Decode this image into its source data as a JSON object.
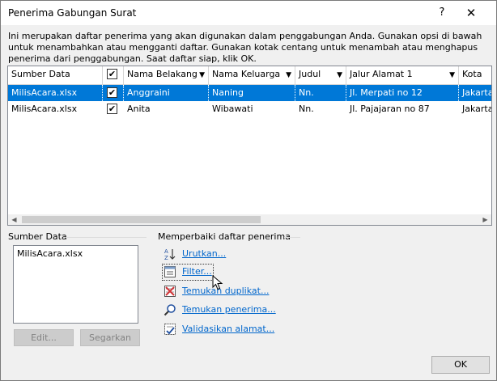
{
  "window": {
    "title": "Penerima Gabungan Surat",
    "help": "?",
    "close": "✕"
  },
  "description": "Ini merupakan daftar penerima yang akan digunakan dalam penggabungan Anda. Gunakan opsi di bawah untuk menambahkan atau mengganti daftar. Gunakan kotak centang untuk menambah atau menghapus penerima dari penggabungan. Saat daftar siap, klik OK.",
  "grid": {
    "columns": [
      {
        "key": "source",
        "label": "Sumber Data"
      },
      {
        "key": "check",
        "label": ""
      },
      {
        "key": "last",
        "label": "Nama Belakang"
      },
      {
        "key": "family",
        "label": "Nama Keluarga"
      },
      {
        "key": "title",
        "label": "Judul"
      },
      {
        "key": "address",
        "label": "Jalur Alamat 1"
      },
      {
        "key": "city",
        "label": "Kota"
      }
    ],
    "header_checkbox": "✔",
    "rows": [
      {
        "source": "MilisAcara.xlsx",
        "check": "✔",
        "last": "Anggraini",
        "family": "Naning",
        "title": "Nn.",
        "address": "Jl. Merpati no 12",
        "city": "Jakarta",
        "selected": true
      },
      {
        "source": "MilisAcara.xlsx",
        "check": "✔",
        "last": "Anita",
        "family": "Wibawati",
        "title": "Nn.",
        "address": "Jl. Pajajaran no 87",
        "city": "Jakarta",
        "selected": false
      }
    ]
  },
  "data_source": {
    "title": "Sumber Data",
    "items": [
      "MilisAcara.xlsx"
    ],
    "edit": "Edit...",
    "refresh": "Segarkan"
  },
  "refine": {
    "title": "Memperbaiki daftar penerima",
    "links": [
      "Urutkan...",
      "Filter...",
      "Temukan duplikat...",
      "Temukan penerima...",
      "Validasikan alamat..."
    ]
  },
  "ok": "OK",
  "colors": {
    "selection": "#0078d7",
    "link": "#0066cc"
  }
}
